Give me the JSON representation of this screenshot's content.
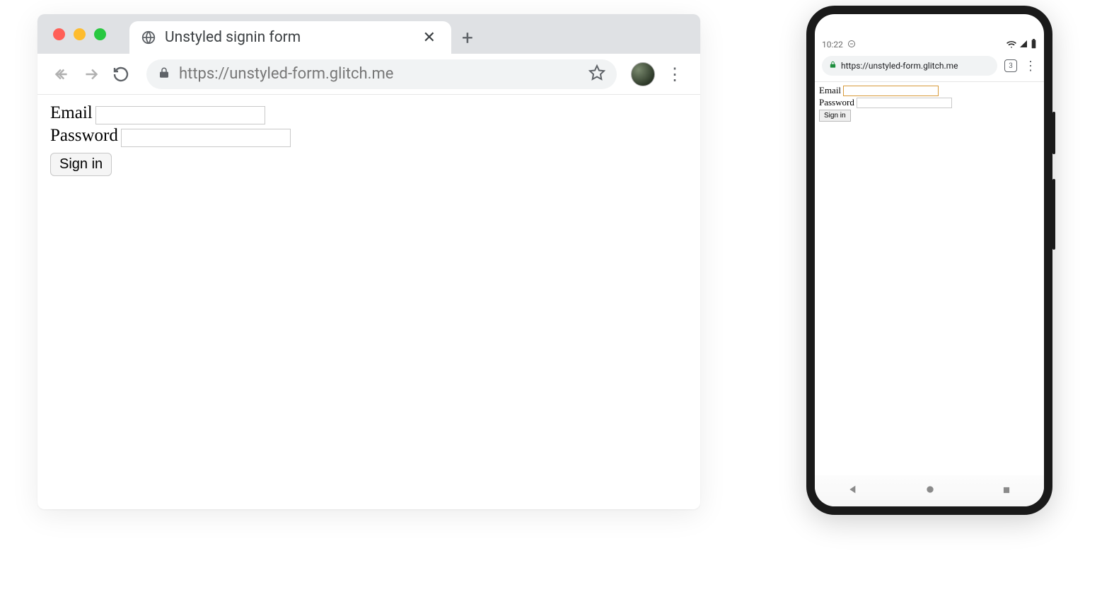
{
  "desktop": {
    "tab_title": "Unstyled signin form",
    "url": "https://unstyled-form.glitch.me",
    "form": {
      "email_label": "Email",
      "password_label": "Password",
      "submit_label": "Sign in"
    }
  },
  "mobile": {
    "time": "10:22",
    "url": "https://unstyled-form.glitch.me",
    "tab_count": "3",
    "form": {
      "email_label": "Email",
      "password_label": "Password",
      "submit_label": "Sign in"
    }
  }
}
